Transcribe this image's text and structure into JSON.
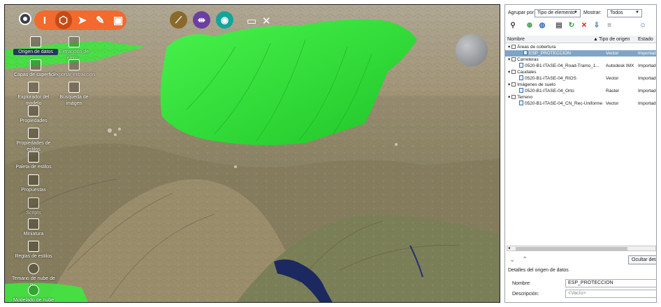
{
  "top_toolbar": {
    "home_icon": "home-icon",
    "group1": [
      "terrain-tool-icon",
      "cube-tool-icon",
      "pointer-icon",
      "pen-icon",
      "layers-icon"
    ],
    "round_tools": [
      {
        "icon": "road-icon",
        "color": "#8a6a2a"
      },
      {
        "icon": "bridge-icon",
        "color": "#6b3fa0"
      },
      {
        "icon": "water-icon",
        "color": "#14a59a"
      }
    ],
    "extra_tools": [
      "monitor-icon",
      "tools-icon"
    ]
  },
  "left_tools": [
    {
      "label": "Origen de datos",
      "icon": "database-icon",
      "selected": true
    },
    {
      "label": "Extracción de elem...",
      "icon": "extract-icon",
      "selected": false
    },
    {
      "label": "Capas de superficie",
      "icon": "surface-layers-icon",
      "selected": false
    },
    {
      "label": "Exportar extracción",
      "icon": "export-icon",
      "selected": false
    },
    {
      "label": "Explorador del modelo",
      "icon": "model-explorer-icon",
      "selected": false
    },
    {
      "label": "Búsqueda de imágen",
      "icon": "image-search-icon",
      "selected": false
    },
    {
      "label": "Propiedades",
      "icon": "properties-icon",
      "selected": false
    },
    {
      "label": "Propiedades de estilos",
      "icon": "style-properties-icon",
      "selected": false
    },
    {
      "label": "Paleta de estilos",
      "icon": "style-palette-icon",
      "selected": false
    },
    {
      "label": "Propuestas",
      "icon": "proposals-icon",
      "selected": false
    },
    {
      "label": "Scripts",
      "icon": "scripts-icon",
      "selected": false
    },
    {
      "label": "Miniatura",
      "icon": "thumbnail-icon",
      "selected": false
    },
    {
      "label": "Reglas de estilos",
      "icon": "style-rules-icon",
      "selected": false
    },
    {
      "label": "Temario de nube de p...",
      "icon": "point-cloud-icon",
      "selected": false
    },
    {
      "label": "Modelado de nube d...",
      "icon": "point-cloud-model-icon",
      "selected": false
    }
  ],
  "panel": {
    "group_by_label": "Agrupar por:",
    "group_by_value": "Tipo de elemento",
    "show_label": "Mostrar:",
    "show_value": "Todos",
    "columns": {
      "name": "Nombre",
      "source_type": "Tipo de origen",
      "state": "Estado"
    },
    "tree": [
      {
        "type": "group",
        "label": "Áreas de cobertura"
      },
      {
        "type": "item",
        "label": "ESP_PROTECCION",
        "source": "Vector",
        "state": "Importad",
        "selected": true
      },
      {
        "type": "group",
        "label": "Carreteras"
      },
      {
        "type": "item",
        "label": "0520-B1-ITASE-04_Road-Tramo_1...",
        "source": "Autodesk IMX",
        "state": "Importad",
        "selected": false
      },
      {
        "type": "group",
        "label": "Caudales"
      },
      {
        "type": "item",
        "label": "0520-B1-ITASE-04_RIOS",
        "source": "Vector",
        "state": "Importad",
        "selected": false
      },
      {
        "type": "group",
        "label": "Imágenes de suelo"
      },
      {
        "type": "item",
        "label": "0520-B1-ITASE-04_Orto",
        "source": "Ráster",
        "state": "Importad",
        "selected": false
      },
      {
        "type": "group",
        "label": "Terreno"
      },
      {
        "type": "item",
        "label": "0520-B1-ITASE-04_CN_Rec-Uniforme",
        "source": "Vector",
        "state": "Importad",
        "selected": false
      }
    ],
    "hide_button": "Ocultar detalle",
    "details_title": "Detalles del origen de datos",
    "name_label": "Nombre:",
    "name_value": "ESP_PROTECCION",
    "description_label": "Descripción:",
    "description_placeholder": "<Vacío>"
  },
  "colors": {
    "accent_orange": "#f26a2e",
    "coverage_green": "#35e83a",
    "selection_blue": "#7fa4c6"
  }
}
